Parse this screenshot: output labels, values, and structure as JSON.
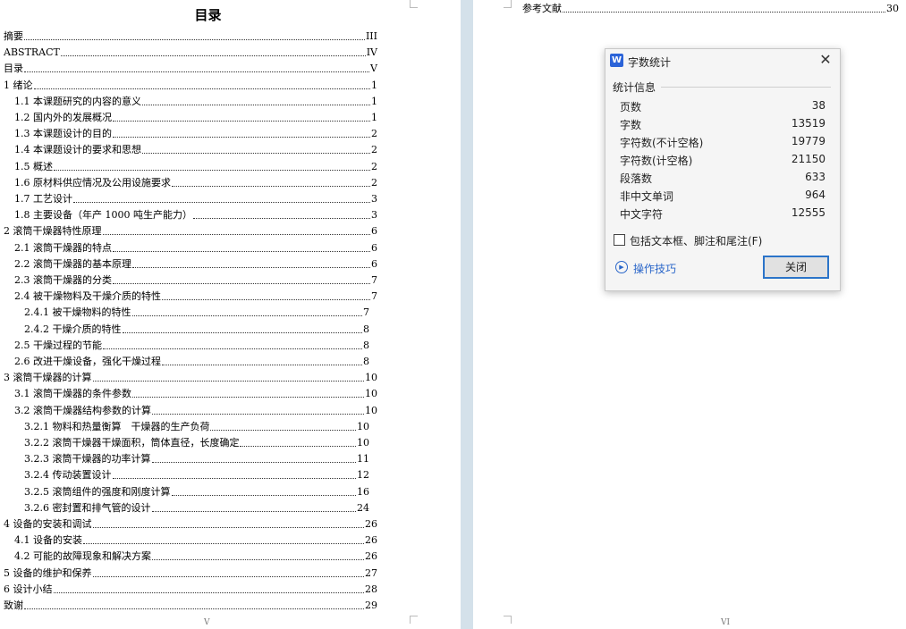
{
  "toc": {
    "title": "目录",
    "entries": [
      {
        "text": "摘要",
        "page": "III"
      },
      {
        "text": "ABSTRACT",
        "page": "IV"
      },
      {
        "text": "目录",
        "page": "V"
      },
      {
        "text": "1 绪论",
        "page": "1"
      },
      {
        "text": "1.1 本课题研究的内容的意义",
        "page": "1"
      },
      {
        "text": "1.2 国内外的发展概况",
        "page": "1"
      },
      {
        "text": "1.3 本课题设计的目的",
        "page": "2"
      },
      {
        "text": "1.4 本课题设计的要求和思想",
        "page": "2"
      },
      {
        "text": "1.5 概述",
        "page": "2"
      },
      {
        "text": "1.6 原材料供应情况及公用设施要求",
        "page": "2"
      },
      {
        "text": "1.7 工艺设计",
        "page": "3"
      },
      {
        "text": "1.8 主要设备（年产 1000 吨生产能力）",
        "page": "3"
      },
      {
        "text": "2 滚筒干燥器特性原理",
        "page": "6"
      },
      {
        "text": "2.1 滚筒干燥器的特点",
        "page": "6"
      },
      {
        "text": "2.2 滚筒干燥器的基本原理",
        "page": "6"
      },
      {
        "text": "2.3 滚筒干燥器的分类",
        "page": "7"
      },
      {
        "text": "2.4 被干燥物料及干燥介质的特性",
        "page": "7"
      },
      {
        "text": "2.4.1 被干燥物料的特性",
        "page": "7"
      },
      {
        "text": "2.4.2 干燥介质的特性",
        "page": "8"
      },
      {
        "text": "2.5 干燥过程的节能",
        "page": "8"
      },
      {
        "text": "2.6 改进干燥设备，强化干燥过程",
        "page": "8"
      },
      {
        "text": "3 滚筒干燥器的计算",
        "page": "10"
      },
      {
        "text": "3.1 滚筒干燥器的条件参数",
        "page": "10"
      },
      {
        "text": "3.2 滚筒干燥器结构参数的计算",
        "page": "10"
      },
      {
        "text": "3.2.1 物料和热量衡算　干燥器的生产负荷",
        "page": "10"
      },
      {
        "text": "3.2.2 滚筒干燥器干燥面积，筒体直径，长度确定",
        "page": "10"
      },
      {
        "text": "3.2.3 滚筒干燥器的功率计算",
        "page": "11"
      },
      {
        "text": "3.2.4 传动装置设计",
        "page": "12"
      },
      {
        "text": "3.2.5 滚筒组件的强度和刚度计算",
        "page": "16"
      },
      {
        "text": "3.2.6 密封置和排气管的设计",
        "page": "24"
      },
      {
        "text": "4 设备的安装和调试",
        "page": "26"
      },
      {
        "text": "4.1 设备的安装",
        "page": "26"
      },
      {
        "text": "4.2 可能的故障现象和解决方案",
        "page": "26"
      },
      {
        "text": "5 设备的维护和保养",
        "page": "27"
      },
      {
        "text": "6 设计小结",
        "page": "28"
      },
      {
        "text": "致谢",
        "page": "29"
      }
    ],
    "footer": "V"
  },
  "right_page": {
    "entry": {
      "text": "参考文献",
      "page": "30"
    },
    "footer": "VI"
  },
  "dialog": {
    "app_icon": "W",
    "title": "字数统计",
    "group_label": "统计信息",
    "stats": [
      {
        "label": "页数",
        "value": "38"
      },
      {
        "label": "字数",
        "value": "13519"
      },
      {
        "label": "字符数(不计空格)",
        "value": "19779"
      },
      {
        "label": "字符数(计空格)",
        "value": "21150"
      },
      {
        "label": "段落数",
        "value": "633"
      },
      {
        "label": "非中文单词",
        "value": "964"
      },
      {
        "label": "中文字符",
        "value": "12555"
      }
    ],
    "checkbox_label": "包括文本框、脚注和尾注(F)",
    "checkbox_checked": false,
    "tips_label": "操作技巧",
    "close_label": "关闭"
  },
  "colors": {
    "accent": "#2b74c9",
    "gutter": "#d4e1ea",
    "app_icon": "#2b63d8"
  }
}
